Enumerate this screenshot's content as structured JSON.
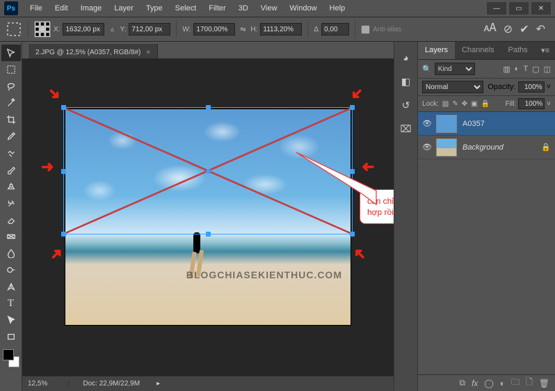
{
  "app": {
    "logo": "Ps"
  },
  "menu": {
    "items": [
      "File",
      "Edit",
      "Image",
      "Layer",
      "Type",
      "Select",
      "Filter",
      "3D",
      "View",
      "Window",
      "Help"
    ]
  },
  "options": {
    "x_label": "X:",
    "x": "1632,00 px",
    "y_label": "Y:",
    "y": "712,00 px",
    "w_label": "W:",
    "w": "1700,00%",
    "h_label": "H:",
    "h": "1113,20%",
    "angle_label": "Δ",
    "angle": "0,00",
    "antialias": "Anti-alias"
  },
  "document": {
    "tab_title": "2.JPG @ 12,5% (A0357, RGB/8#)",
    "zoom": "12,5%",
    "status_doc": "Doc: 22,9M/22,9M",
    "watermark": "BLOGCHIASEKIENTHUC.COM"
  },
  "callout": {
    "text": "căn chỉnh file đám mây phù hợp rồi Enter"
  },
  "panels": {
    "tabs": [
      "Layers",
      "Channels",
      "Paths"
    ],
    "kind_placeholder": "Kind",
    "blend_mode": "Normal",
    "opacity_label": "Opacity:",
    "opacity": "100%",
    "lock_label": "Lock:",
    "fill_label": "Fill:",
    "fill": "100%",
    "layers": [
      {
        "name": "A0357",
        "selected": true,
        "italic": false
      },
      {
        "name": "Background",
        "selected": false,
        "italic": true,
        "locked": true
      }
    ]
  }
}
